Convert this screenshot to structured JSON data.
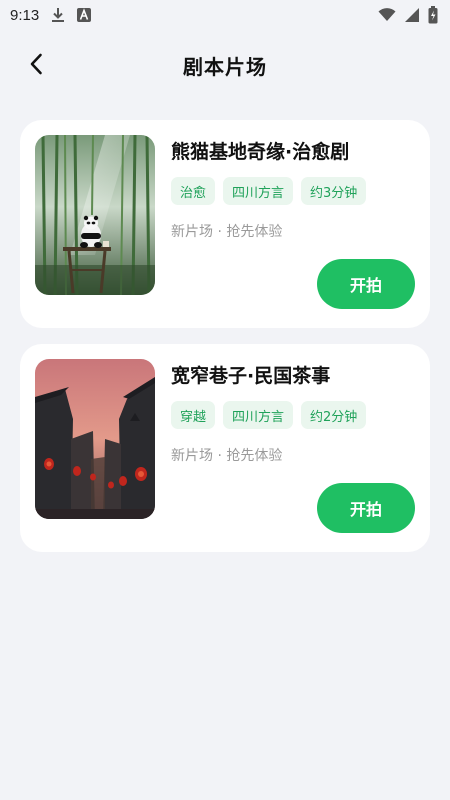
{
  "status_bar": {
    "time": "9:13",
    "icons": [
      "download-icon",
      "text-a-icon",
      "wifi-icon",
      "signal-icon",
      "battery-charging-icon"
    ]
  },
  "header": {
    "back_icon": "chevron-left-icon",
    "title": "剧本片场"
  },
  "scripts": [
    {
      "title": "熊猫基地奇缘·治愈剧",
      "tags": [
        "治愈",
        "四川方言",
        "约3分钟"
      ],
      "subtitle": "新片场 · 抢先体验",
      "button": "开拍",
      "image": "panda-in-bamboo-forest"
    },
    {
      "title": "宽窄巷子·民国茶事",
      "tags": [
        "穿越",
        "四川方言",
        "约2分钟"
      ],
      "subtitle": "新片场 · 抢先体验",
      "button": "开拍",
      "image": "old-street-with-red-lanterns"
    }
  ],
  "colors": {
    "background": "#f2f3f7",
    "accent": "#1fbf63",
    "tag_bg": "#eaf6ee",
    "tag_text": "#20a25a"
  }
}
